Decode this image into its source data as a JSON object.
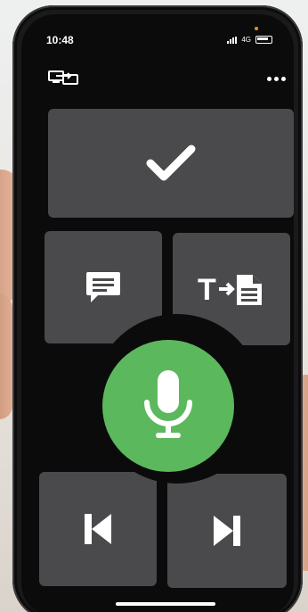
{
  "status_bar": {
    "time": "10:48",
    "network": "4G"
  },
  "toolbar": {
    "left_icon": "screen-mirror-icon",
    "right_icon": "more-options-icon"
  },
  "buttons": {
    "confirm": {
      "icon": "checkmark-icon"
    },
    "comment": {
      "icon": "comment-icon"
    },
    "transcribe": {
      "icon": "text-to-document-icon",
      "label": "T"
    },
    "record": {
      "icon": "microphone-icon"
    },
    "previous": {
      "icon": "skip-previous-icon"
    },
    "next": {
      "icon": "skip-next-icon"
    }
  },
  "colors": {
    "screen_background": "#0b0b0c",
    "button_gray": "#4a4a4c",
    "record_green": "#5cb85c",
    "icon_white": "#ffffff"
  }
}
